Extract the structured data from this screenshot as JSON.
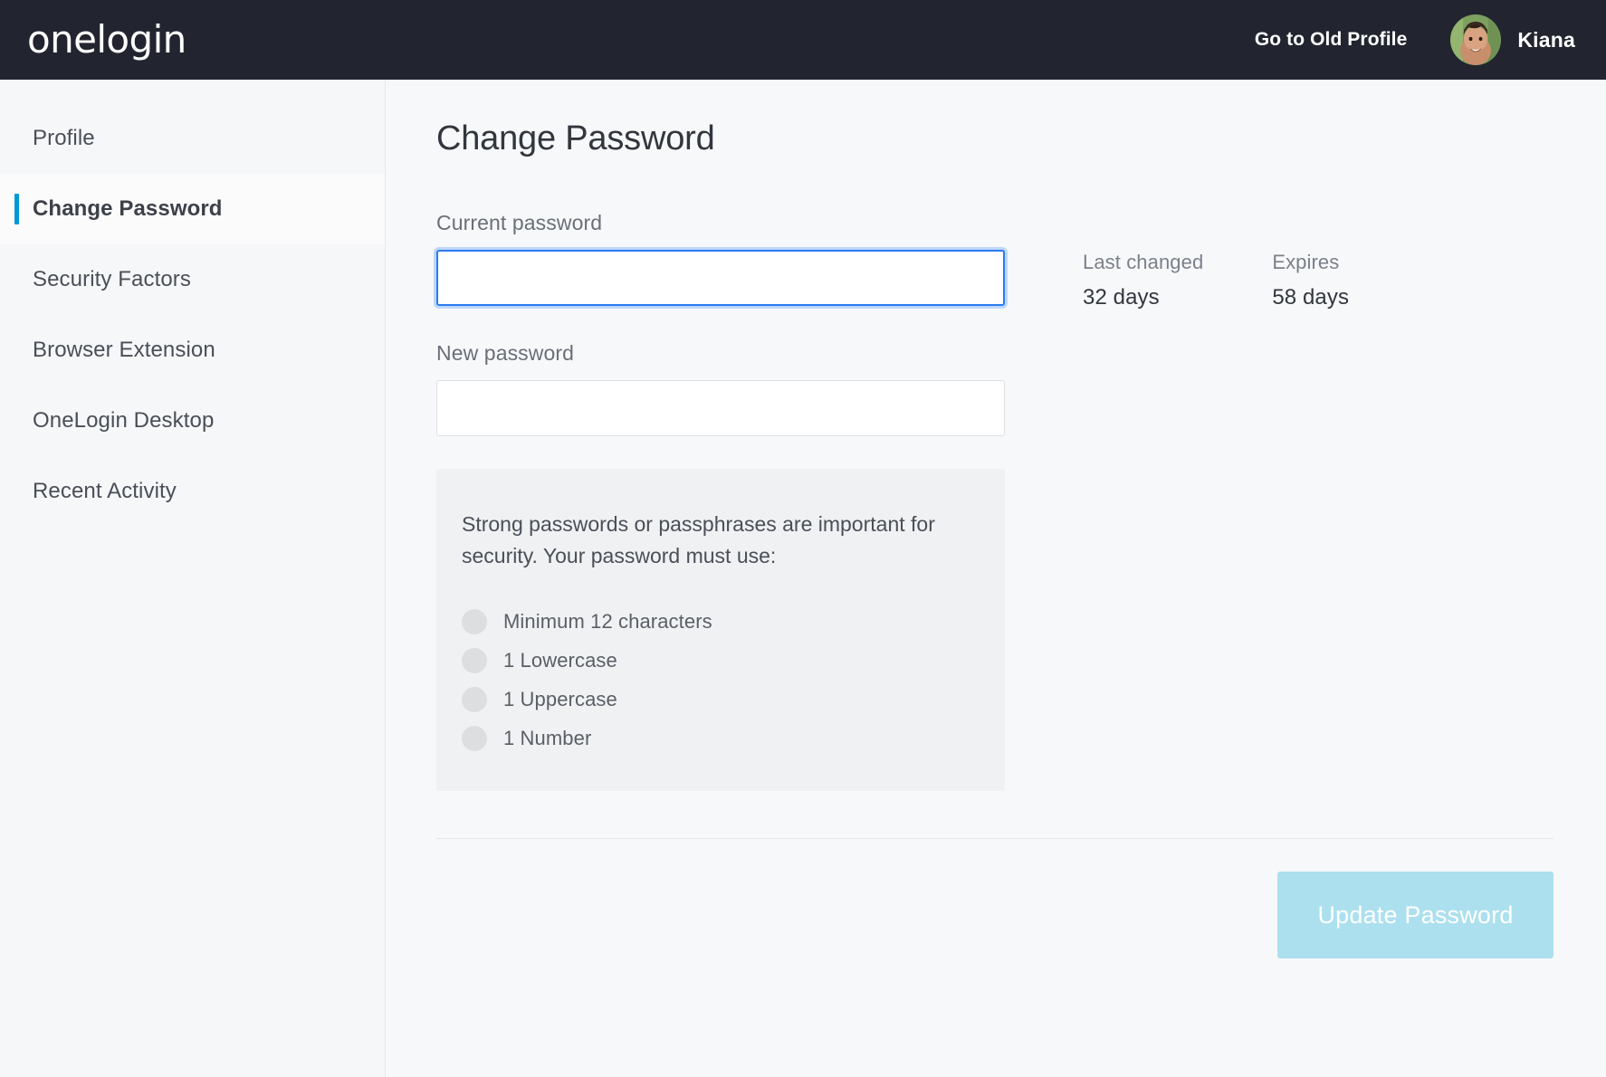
{
  "header": {
    "brand": "onelogin",
    "old_profile_link": "Go to Old Profile",
    "user_name": "Kiana",
    "avatar_alt": "user-avatar-photo",
    "background_color": "#22252f"
  },
  "sidebar": {
    "items": [
      {
        "label": "Profile",
        "active": false
      },
      {
        "label": "Change Password",
        "active": true
      },
      {
        "label": "Security Factors",
        "active": false
      },
      {
        "label": "Browser Extension",
        "active": false
      },
      {
        "label": "OneLogin Desktop",
        "active": false
      },
      {
        "label": "Recent Activity",
        "active": false
      }
    ],
    "active_accent_color": "#0198d8"
  },
  "main": {
    "page_title": "Change Password",
    "fields": {
      "current_password": {
        "label": "Current password",
        "value": "",
        "placeholder": "",
        "focused": true
      },
      "new_password": {
        "label": "New password",
        "value": "",
        "placeholder": "",
        "focused": false
      }
    },
    "meta": [
      {
        "label": "Last changed",
        "value": "32 days"
      },
      {
        "label": "Expires",
        "value": "58 days"
      }
    ],
    "requirements": {
      "intro": "Strong passwords or passphrases are important for security. Your password must use:",
      "items": [
        "Minimum 12 characters",
        "1 Lowercase",
        "1 Uppercase",
        "1 Number"
      ],
      "background_color": "#f0f1f3",
      "bullet_color": "#dcdee0"
    },
    "submit_button": {
      "label": "Update Password",
      "disabled": true,
      "background_color": "#ace0ee"
    }
  }
}
